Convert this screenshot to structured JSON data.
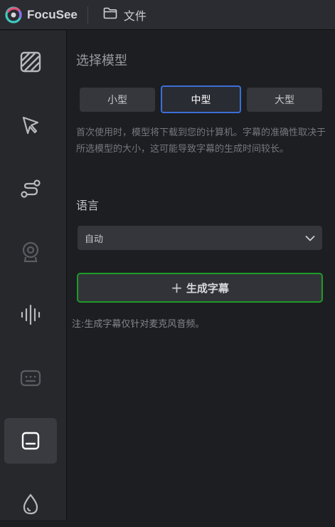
{
  "app": {
    "brand": "FocuSee",
    "file_label": "文件"
  },
  "sidebar": {
    "items": [
      {
        "icon": "background-pattern-icon",
        "active": false
      },
      {
        "icon": "cursor-icon",
        "active": false
      },
      {
        "icon": "path-animation-icon",
        "active": false
      },
      {
        "icon": "webcam-icon",
        "active": false
      },
      {
        "icon": "audio-waveform-icon",
        "active": false
      },
      {
        "icon": "keyboard-icon",
        "active": false
      },
      {
        "icon": "captions-icon",
        "active": true
      },
      {
        "icon": "watermark-drop-icon",
        "active": false
      }
    ]
  },
  "main": {
    "section_title": "选择模型",
    "models": [
      {
        "label": "小型",
        "selected": false
      },
      {
        "label": "中型",
        "selected": true
      },
      {
        "label": "大型",
        "selected": false
      }
    ],
    "description": "首次使用时，模型将下载到您的计算机。字幕的准确性取决于所选模型的大小，这可能导致字幕的生成时间较长。",
    "language_label": "语言",
    "language_value": "自动",
    "generate_plus": "+",
    "generate_label": "生成字幕",
    "note": "注:生成字幕仅针对麦克风音频。"
  },
  "colors": {
    "accent_selected": "#3b6fd8",
    "generate_border": "#1f9a28",
    "background": "#1d1e22"
  }
}
